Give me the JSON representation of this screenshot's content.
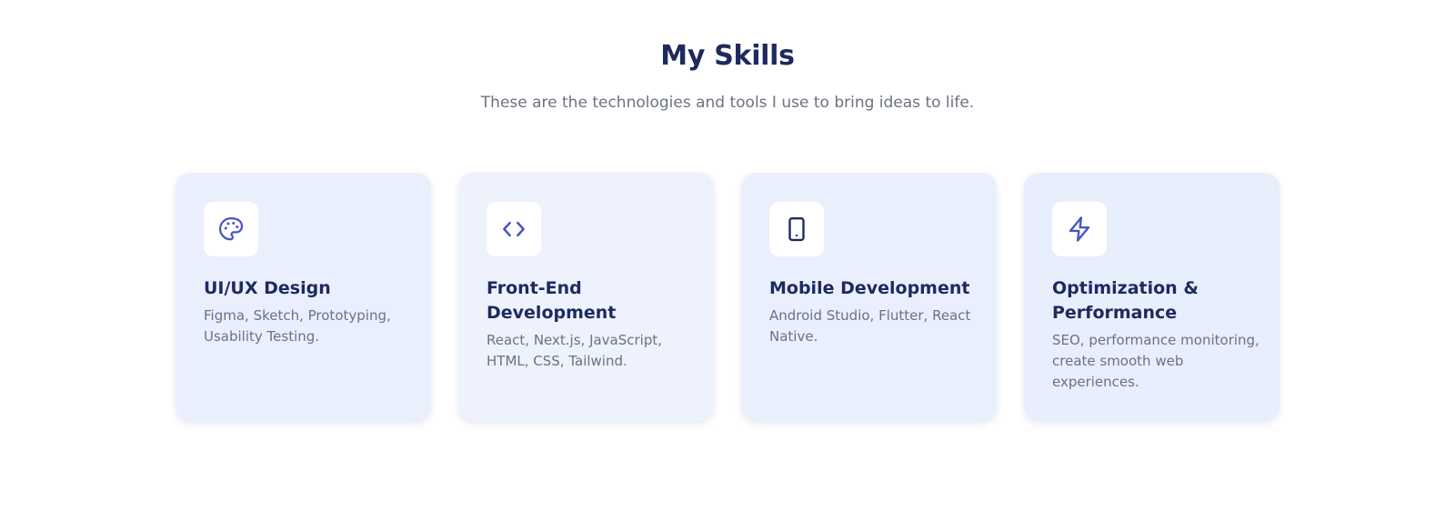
{
  "header": {
    "title": "My Skills",
    "subtitle": "These are the technologies and tools I use to bring ideas to life."
  },
  "colors": {
    "title": "#1e2a5e",
    "text_muted": "#6b7280",
    "icon_accent": "#4756c2",
    "card_bg": "#e9effd"
  },
  "skills": [
    {
      "icon": "palette-icon",
      "title": "UI/UX Design",
      "description": "Figma, Sketch, Prototyping, Usability Testing."
    },
    {
      "icon": "code-icon",
      "title": "Front-End Development",
      "description": "React, Next.js, JavaScript, HTML, CSS, Tailwind."
    },
    {
      "icon": "tablet-icon",
      "title": "Mobile Development",
      "description": "Android Studio, Flutter, React Native."
    },
    {
      "icon": "lightning-icon",
      "title": "Optimization & Performance",
      "description": "SEO, performance monitoring, create smooth web experiences."
    }
  ]
}
